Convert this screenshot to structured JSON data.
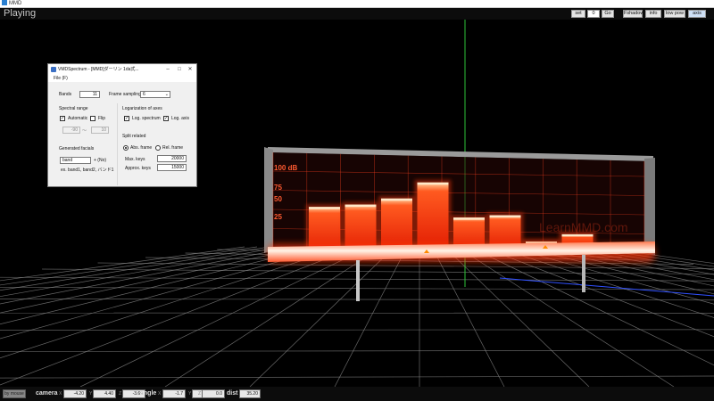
{
  "window": {
    "title": "MMD"
  },
  "topbar": {
    "status": "Playing",
    "set_label": "set",
    "frame_value": "0",
    "go_label": "Go",
    "shadow_label": "Fshadow",
    "info_label": "info",
    "lowpow_label": "low pow",
    "axis_label": "axis"
  },
  "dialog": {
    "title": "VMDSpectrum - [MMD]ダーリン 1da式...",
    "menu_file": "File (F)",
    "bands_label": "Bands",
    "bands_value": "11",
    "frame_sampling_label": "Frame sampling",
    "frame_sampling_value": "6",
    "spectral_range_label": "Spectral range",
    "automatic_label": "Automatic",
    "flip_label": "Flip",
    "range_min": "-90",
    "range_sep": "～",
    "range_max": "10",
    "log_axes_label": "Logarization of axes",
    "log_spectrum_label": "Log. spectrum",
    "log_axis_label": "Log. axis",
    "split_label": "Split related",
    "abs_frame_label": "Abs. frame",
    "rel_frame_label": "Rel. frame",
    "max_keys_label": "Max. keys",
    "max_keys_value": "20000",
    "approx_keys_label": "Approx. keys",
    "approx_keys_value": "15000",
    "facials_label": "Generated facials",
    "facial_name_value": "band",
    "facial_suffix": "+ (No)",
    "facial_example": "ex. band1, band2, バンド1"
  },
  "scene": {
    "panel_labels": [
      "100 dB",
      "75",
      "50",
      "25"
    ],
    "watermark": "LearnMMD.com",
    "bar_levels_percent": [
      41,
      42,
      46,
      58,
      29,
      30,
      8,
      13
    ],
    "bar_color": "#ff3a10",
    "grid_color": "#8a8a8a",
    "axis_green": "#2ec43a",
    "axis_blue": "#3050ff"
  },
  "bottombar": {
    "mode_label": "by mouse",
    "camera_label": "camera",
    "camera_x": "-4.20",
    "camera_y": "4.40",
    "camera_z": "-3.69",
    "angle_label": "angle",
    "angle_x": "-1.7",
    "angle_y": "-30.7",
    "angle_z": "0.0",
    "dist_label": "dist",
    "dist_value": "35.20",
    "axis_x": "X",
    "axis_y": "Y",
    "axis_z": "Z"
  }
}
